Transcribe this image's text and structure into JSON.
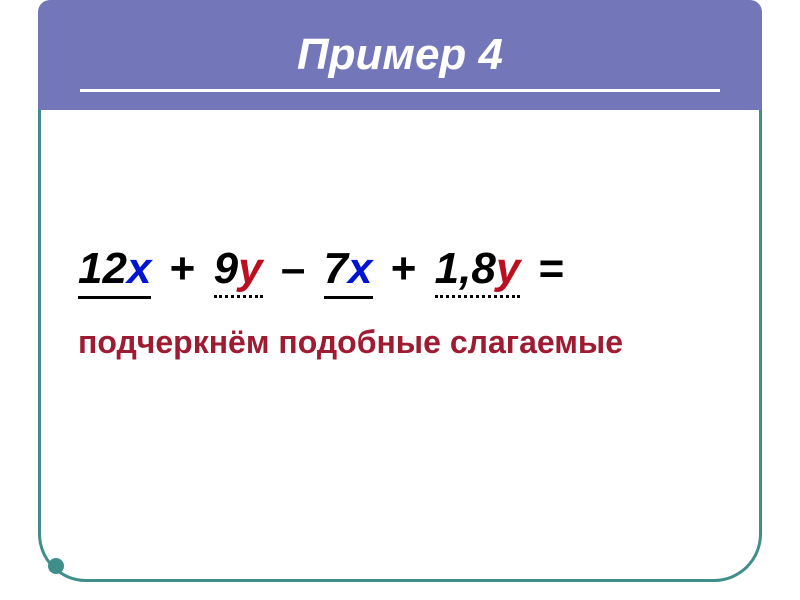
{
  "header": {
    "title": "Пример 4"
  },
  "expression": {
    "term1": {
      "coef": "12",
      "var": "х"
    },
    "op1": "+",
    "term2": {
      "coef": "9",
      "var": "у"
    },
    "op2": "–",
    "term3": {
      "coef": "7",
      "var": "х"
    },
    "op3": "+",
    "term4": {
      "coef": "1,8",
      "var": "у"
    },
    "equals": "="
  },
  "caption": "подчеркнём подобные слагаемые"
}
